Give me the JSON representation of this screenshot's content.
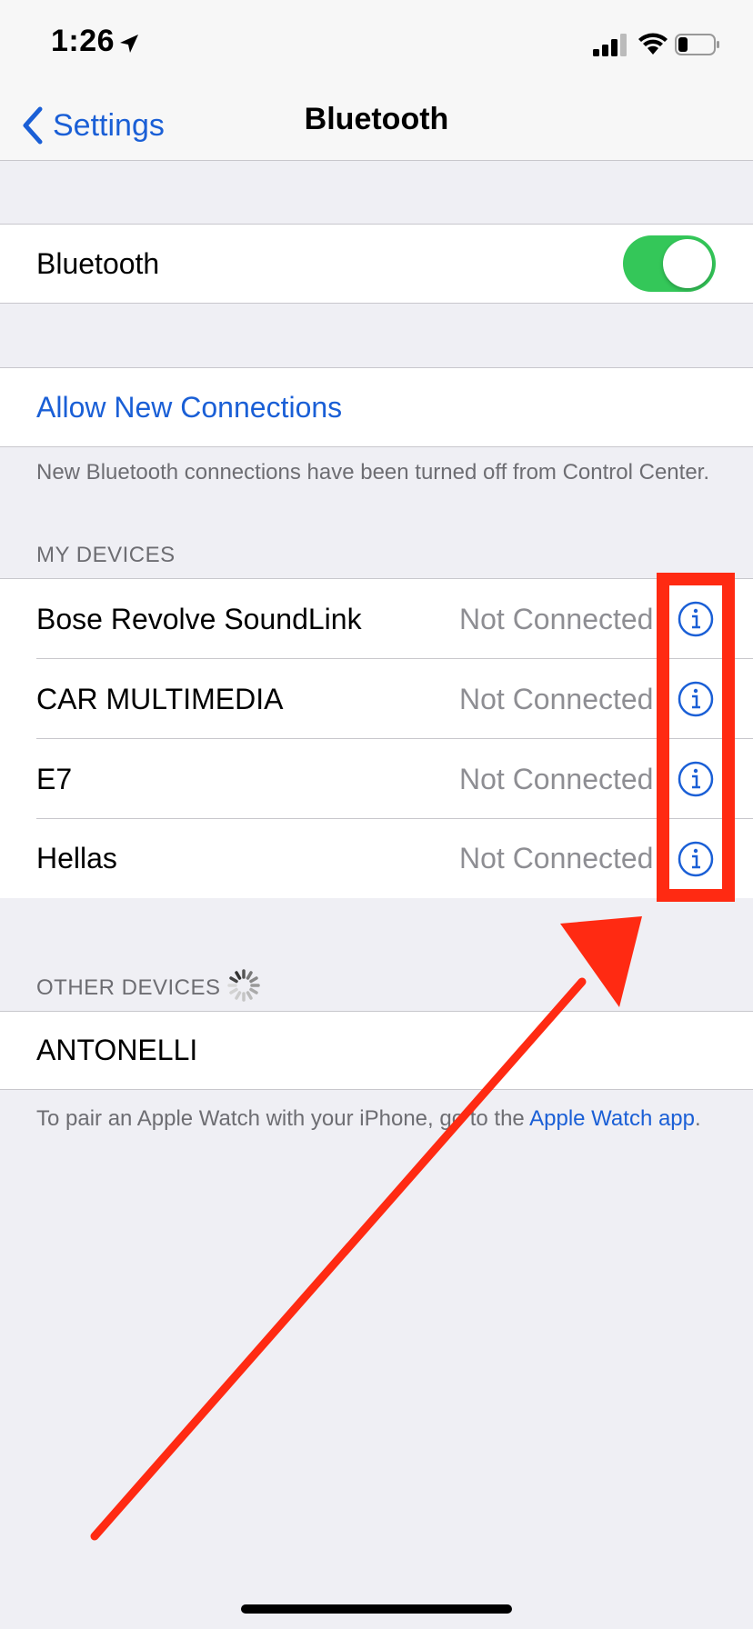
{
  "status_bar": {
    "time": "1:26",
    "icons": [
      "location-arrow-icon",
      "cellular-signal-icon",
      "wifi-icon",
      "battery-icon"
    ]
  },
  "nav": {
    "back_label": "Settings",
    "title": "Bluetooth"
  },
  "bluetooth_toggle": {
    "label": "Bluetooth",
    "state": "on"
  },
  "allow_new_connections": {
    "label": "Allow New Connections",
    "footnote": "New Bluetooth connections have been turned off from Control Center."
  },
  "my_devices": {
    "header": "MY DEVICES",
    "devices": [
      {
        "name": "Bose Revolve SoundLink",
        "status": "Not Connected"
      },
      {
        "name": "CAR MULTIMEDIA",
        "status": "Not Connected"
      },
      {
        "name": "E7",
        "status": "Not Connected"
      },
      {
        "name": "Hellas",
        "status": "Not Connected"
      }
    ]
  },
  "other_devices": {
    "header": "OTHER DEVICES",
    "devices": [
      {
        "name": "ANTONELLI"
      }
    ]
  },
  "footer": {
    "text_before": "To pair an Apple Watch with your iPhone, go to the ",
    "link": "Apple Watch app",
    "text_after": "."
  },
  "colors": {
    "accent": "#1a5fd6",
    "toggle_on": "#34c759",
    "annotation": "#ff2a12",
    "background": "#efeff4"
  }
}
